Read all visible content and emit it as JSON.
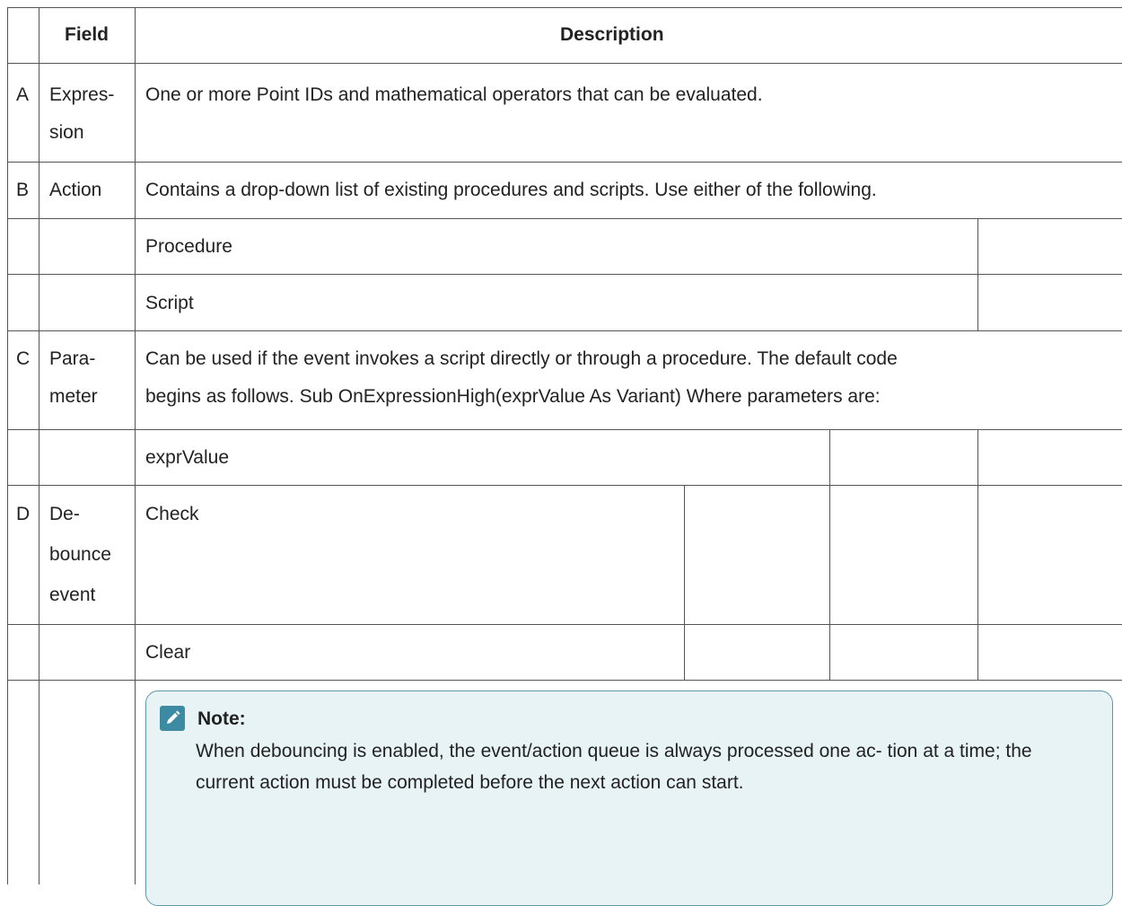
{
  "header": {
    "field": "Field",
    "description": "Description"
  },
  "rows": [
    {
      "letter": "A",
      "field": [
        "Expres-",
        "sion"
      ],
      "description": "One or more Point IDs and mathematical operators that can be evaluated."
    },
    {
      "letter": "B",
      "field": [
        "Action"
      ],
      "description": "Contains a drop-down list of existing procedures and scripts. Use either of the following."
    },
    {
      "sub": "Procedure"
    },
    {
      "sub": "Script"
    },
    {
      "letter": "C",
      "field": [
        "Para-",
        "meter"
      ],
      "description": [
        "Can be used if the event invokes a script directly or through a procedure. The default code",
        "begins as follows. Sub OnExpressionHigh(exprValue As Variant) Where parameters are:"
      ]
    },
    {
      "sub": "exprValue"
    },
    {
      "letter": "D",
      "field": [
        "De-",
        "bounce",
        "event"
      ],
      "description": "Check"
    },
    {
      "sub": "Clear"
    }
  ],
  "note": {
    "title": "Note:",
    "text": "When debouncing is enabled, the event/action queue is always processed one ac- tion at a time; the current action must be completed before the next action can start.",
    "icon": "pencil-icon",
    "colors": {
      "background": "#e8f3f6",
      "border": "#5f97aa",
      "icon": "#3d8ba3"
    }
  }
}
